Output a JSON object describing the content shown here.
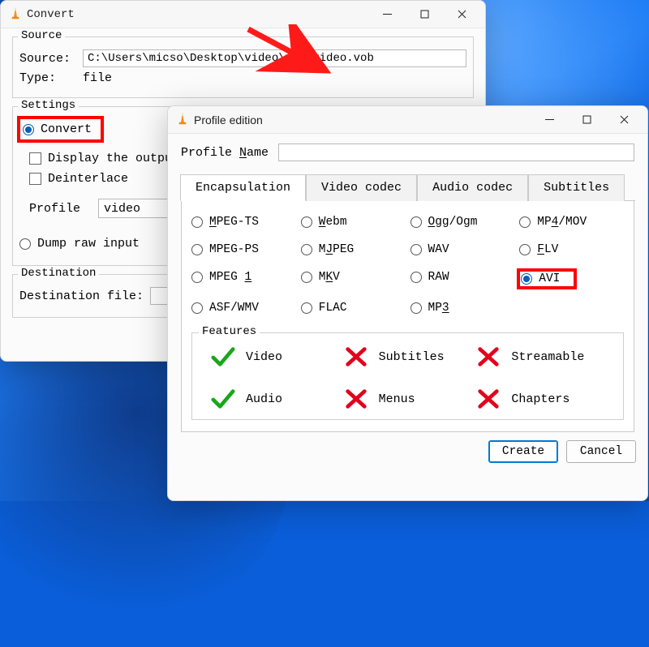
{
  "desktop": {},
  "accent": "#0078d4",
  "highlight_color": "#ff0000",
  "convert_window": {
    "title": "Convert",
    "source_group": "Source",
    "source_label": "Source:",
    "source_value": "C:\\Users\\micso\\Desktop\\video\\vob video.vob",
    "type_label": "Type:",
    "type_value": "file",
    "settings_group": "Settings",
    "convert_radio": "Convert",
    "display_output_chk": "Display the output",
    "deinterlace_chk": "Deinterlace",
    "profile_label": "Profile",
    "profile_value": "video",
    "dump_radio": "Dump raw input",
    "destination_group": "Destination",
    "destination_label": "Destination file:"
  },
  "profile_window": {
    "title": "Profile edition",
    "name_label_pre": "Profile ",
    "name_label_u": "N",
    "name_label_post": "ame",
    "name_value": "",
    "tabs": [
      {
        "label": "Encapsulation",
        "active": true
      },
      {
        "label": "Video codec",
        "active": false
      },
      {
        "label": "Audio codec",
        "active": false
      },
      {
        "label": "Subtitles",
        "active": false
      }
    ],
    "formats": [
      {
        "l": "MPEG-TS",
        "u": "M"
      },
      {
        "l": "Webm",
        "u": "W"
      },
      {
        "l": "Ogg/Ogm",
        "u": "O"
      },
      {
        "l": "MP4/MOV",
        "u": "4"
      },
      {
        "l": "MPEG-PS",
        "u": ""
      },
      {
        "l": "MJPEG",
        "u": "J"
      },
      {
        "l": "WAV",
        "u": ""
      },
      {
        "l": "FLV",
        "u": "F"
      },
      {
        "l": "MPEG 1",
        "u": "1"
      },
      {
        "l": "MKV",
        "u": "K"
      },
      {
        "l": "RAW",
        "u": ""
      },
      {
        "l": "AVI",
        "u": "",
        "selected": true,
        "highlight": true
      },
      {
        "l": "ASF/WMV",
        "u": ""
      },
      {
        "l": "FLAC",
        "u": ""
      },
      {
        "l": "MP3",
        "u": "3"
      }
    ],
    "features_group": "Features",
    "features": [
      {
        "name": "Video",
        "ok": true
      },
      {
        "name": "Subtitles",
        "ok": false
      },
      {
        "name": "Streamable",
        "ok": false
      },
      {
        "name": "Audio",
        "ok": true
      },
      {
        "name": "Menus",
        "ok": false
      },
      {
        "name": "Chapters",
        "ok": false
      }
    ],
    "create_btn": "Create",
    "cancel_btn": "Cancel"
  }
}
